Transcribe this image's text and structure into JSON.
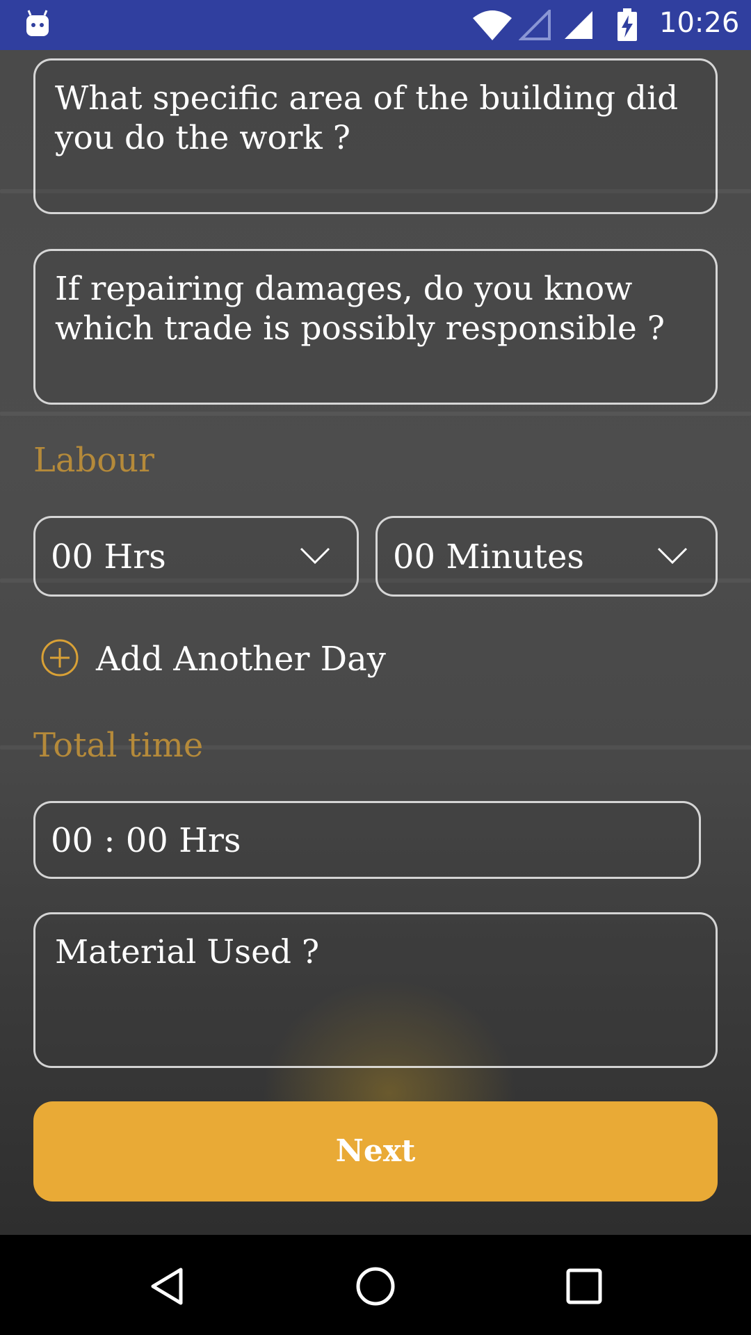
{
  "status_bar": {
    "time": "10:26"
  },
  "form": {
    "area_placeholder": "What specific area of the building did you do the work ?",
    "trade_placeholder": "If repairing damages, do you know which trade is possibly responsible ?",
    "labour_label": "Labour",
    "hours_value": "00 Hrs",
    "minutes_value": "00 Minutes",
    "add_day_label": "Add Another Day",
    "total_time_label": "Total time",
    "total_time_value": "00 : 00 Hrs",
    "material_placeholder": "Material Used ?",
    "next_label": "Next"
  },
  "colors": {
    "status_bar": "#303f9f",
    "accent_label": "#b58a3a",
    "button": "#e9aa36"
  },
  "icons": [
    "android-app-icon",
    "wifi-icon",
    "signal-empty-icon",
    "signal-icon",
    "battery-charging-icon",
    "chevron-down-icon",
    "add-circle-icon",
    "back-icon",
    "home-icon",
    "recents-icon"
  ]
}
